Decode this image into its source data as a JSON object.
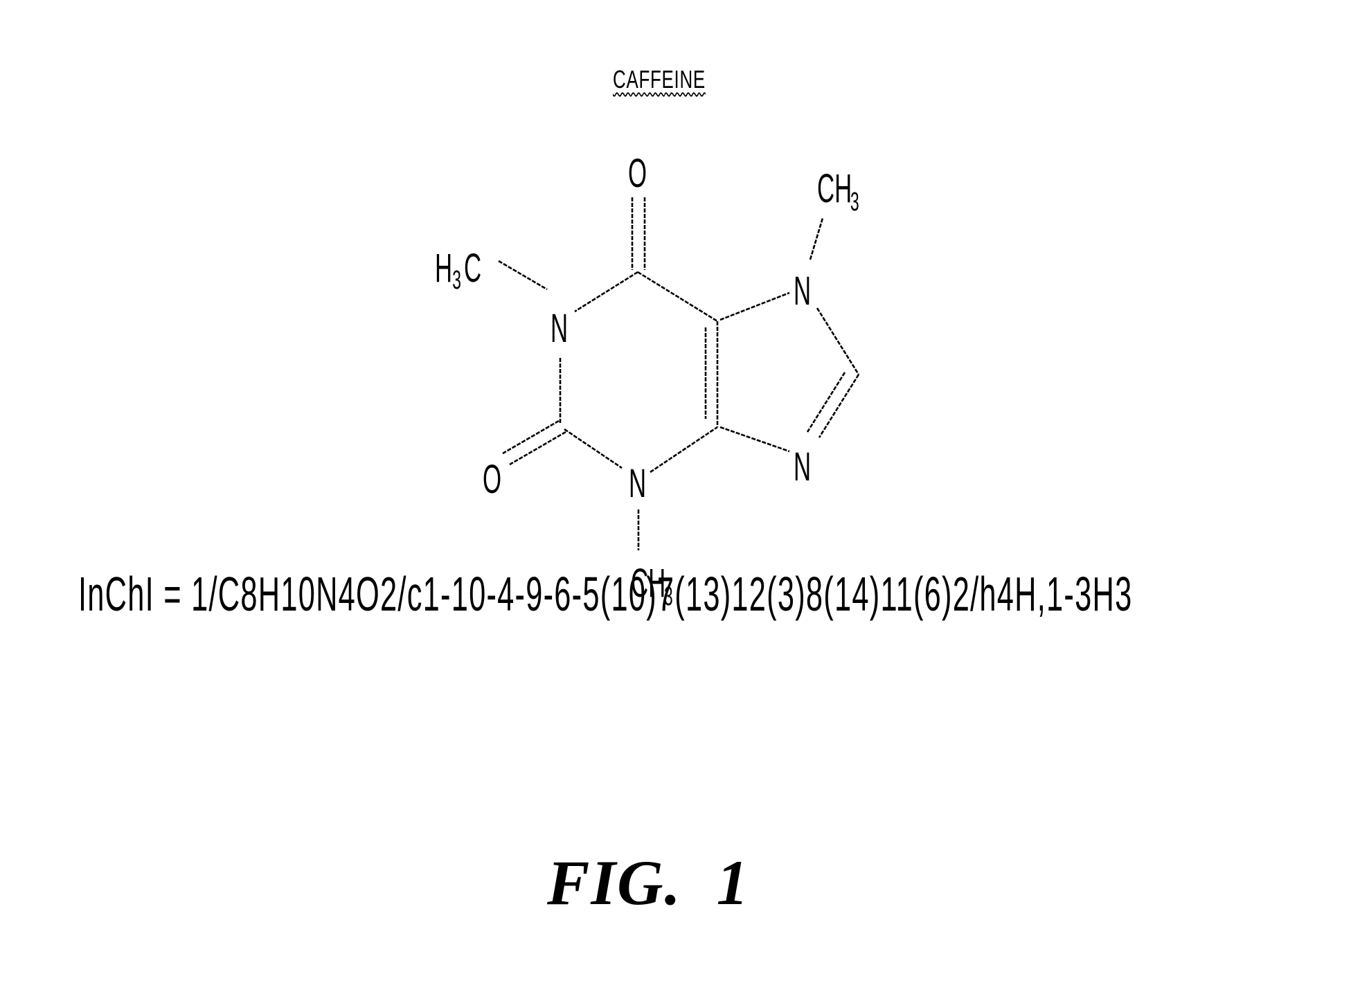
{
  "figure": {
    "title": "CAFFEINE",
    "caption": "FIG.  1",
    "inchi": "InChI = 1/C8H10N4O2/c1-10-4-9-6-5(10)7(13)12(3)8(14)11(6)2/h4H,1-3H3"
  },
  "molecule": {
    "name": "Caffeine",
    "formula": "C8H10N4O2",
    "atom_labels": {
      "o_top": "O",
      "o_left": "O",
      "n1": "N",
      "n3": "N",
      "n7": "N",
      "n9": "N",
      "methyl_left_main": "H",
      "methyl_left_sub": "3",
      "methyl_left_tail": "C",
      "methyl_bottom_main": "CH",
      "methyl_bottom_sub": "3",
      "methyl_top_main": "CH",
      "methyl_top_sub": "3"
    }
  }
}
